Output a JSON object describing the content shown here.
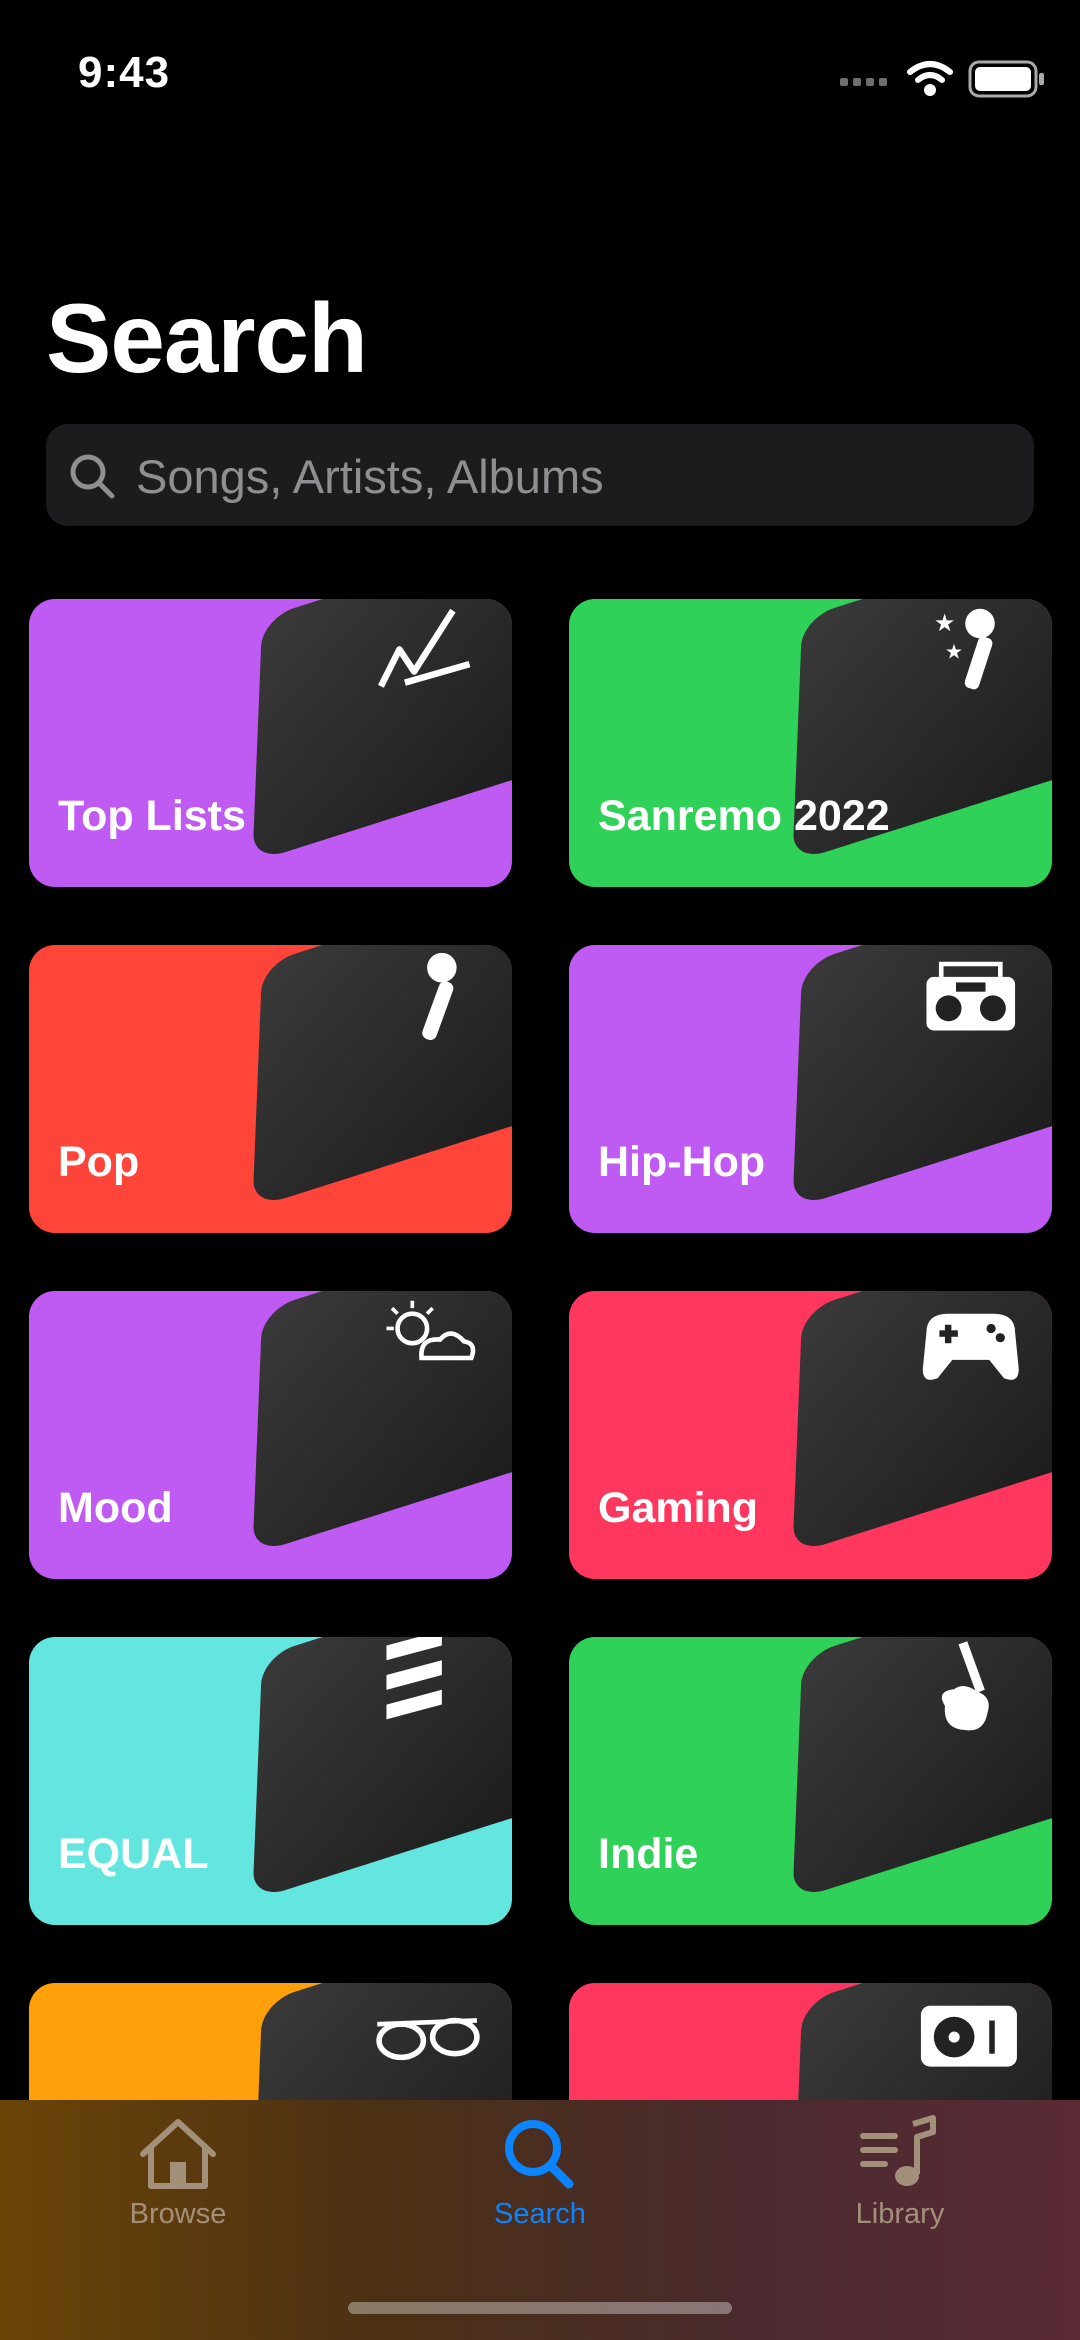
{
  "status_bar": {
    "time": "9:43"
  },
  "page": {
    "title": "Search",
    "search": {
      "placeholder": "Songs, Artists, Albums",
      "value": ""
    }
  },
  "categories": [
    {
      "label": "Top Lists",
      "color": "#bf5af2",
      "icon": "chart-icon"
    },
    {
      "label": "Sanremo 2022",
      "color": "#30d158",
      "icon": "microphone-stars-icon"
    },
    {
      "label": "Pop",
      "color": "#ff453a",
      "icon": "microphone-icon"
    },
    {
      "label": "Hip-Hop",
      "color": "#bf5af2",
      "icon": "boombox-icon"
    },
    {
      "label": "Mood",
      "color": "#bf5af2",
      "icon": "weather-icon"
    },
    {
      "label": "Gaming",
      "color": "#ff375f",
      "icon": "gamepad-icon"
    },
    {
      "label": "EQUAL",
      "color": "#64e6e0",
      "icon": "equal-bars-icon"
    },
    {
      "label": "Indie",
      "color": "#30d158",
      "icon": "guitar-icon"
    },
    {
      "label": "",
      "color": "#ff9f0a",
      "icon": "sunglasses-icon"
    },
    {
      "label": "",
      "color": "#ff375f",
      "icon": "turntable-icon"
    }
  ],
  "tab_bar": {
    "tabs": [
      {
        "label": "Browse",
        "icon": "home-icon",
        "active": false
      },
      {
        "label": "Search",
        "icon": "search-icon",
        "active": true
      },
      {
        "label": "Library",
        "icon": "music-list-icon",
        "active": false
      }
    ],
    "active_color": "#0a84ff"
  }
}
